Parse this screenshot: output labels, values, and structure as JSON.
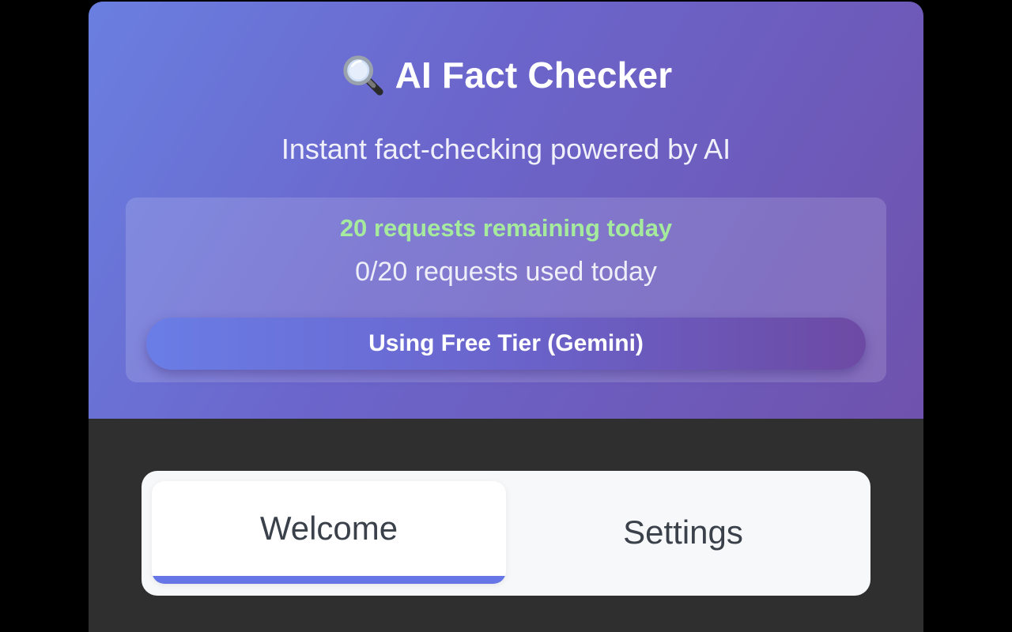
{
  "header": {
    "title": "AI Fact Checker",
    "title_icon": "magnifying-glass-icon",
    "subtitle": "Instant fact-checking powered by AI"
  },
  "usage": {
    "remaining_text": "20 requests remaining today",
    "used_text": "0/20 requests used today",
    "tier_label": "Using Free Tier (Gemini)"
  },
  "tabs": [
    {
      "label": "Welcome",
      "active": true
    },
    {
      "label": "Settings",
      "active": false
    }
  ],
  "colors": {
    "header_gradient_start": "#6a7fe0",
    "header_gradient_end": "#6f52ad",
    "remaining_green": "#a6ea9d",
    "active_tab_underline": "#6776e6",
    "body_background": "#2f2f2f"
  }
}
